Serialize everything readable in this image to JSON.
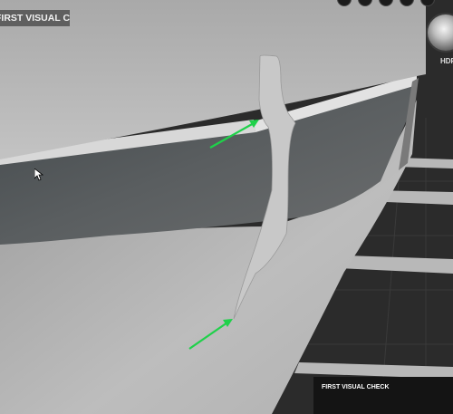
{
  "viewport": {
    "mode_label": "FIRST VISUAL CHECK",
    "hdr_label": "HDR",
    "bottom_panel_title": "FIRST VISUAL CHECK"
  },
  "annotations": {
    "arrow_color": "#1fd14a",
    "arrow_count": 2
  },
  "icons": {
    "hdr": "hdr-sphere-icon",
    "cursor": "mouse-cursor-icon",
    "top_buttons": [
      "toolbar-circle-icon",
      "toolbar-circle-icon",
      "toolbar-circle-icon",
      "toolbar-circle-icon",
      "toolbar-circle-icon"
    ]
  },
  "colors": {
    "background": "#2b2b2b",
    "hull_light": "#b5b5b5",
    "hull_dark": "#535759",
    "panel": "#141414"
  }
}
